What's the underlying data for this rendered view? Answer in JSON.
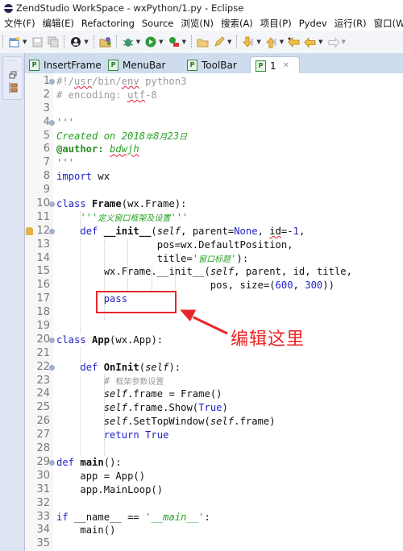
{
  "window": {
    "title": "ZendStudio WorkSpace - wxPython/1.py - Eclipse"
  },
  "menubar": {
    "items": [
      "文件(F)",
      "编辑(E)",
      "Refactoring",
      "Source",
      "浏览(N)",
      "搜索(A)",
      "项目(P)",
      "Pydev",
      "运行(R)",
      "窗口(W)"
    ]
  },
  "toolbar": {
    "icons": [
      "new-file-icon",
      "save-icon",
      "save-all-icon",
      "profile-icon",
      "open-project-icon",
      "debug-bug-icon",
      "run-icon",
      "external-tools-icon",
      "open-folder-icon",
      "pencil-icon",
      "next-annotation-icon",
      "prev-annotation-icon",
      "last-edit-icon",
      "back-icon",
      "forward-icon"
    ]
  },
  "tabs": [
    {
      "label": "InsertFrame",
      "active": false
    },
    {
      "label": "MenuBar",
      "active": false
    },
    {
      "label": "ToolBar",
      "active": false
    },
    {
      "label": "1",
      "active": true,
      "close": "✕"
    }
  ],
  "editor": {
    "lines": [
      {
        "n": "1",
        "text": "#!/usr/bin/env python3"
      },
      {
        "n": "2",
        "text": "# encoding: utf-8"
      },
      {
        "n": "3",
        "text": ""
      },
      {
        "n": "4",
        "text": "'''"
      },
      {
        "n": "5",
        "text": "Created on 2018年8月23日"
      },
      {
        "n": "6",
        "text": "@author: bdwjh"
      },
      {
        "n": "7",
        "text": "'''"
      },
      {
        "n": "8",
        "text": "import wx"
      },
      {
        "n": "9",
        "text": ""
      },
      {
        "n": "10",
        "text": "class Frame(wx.Frame):"
      },
      {
        "n": "11",
        "text": "    '''定义窗口框架及设置'''"
      },
      {
        "n": "12",
        "text": "    def __init__(self, parent=None, id=-1,"
      },
      {
        "n": "13",
        "text": "                 pos=wx.DefaultPosition,"
      },
      {
        "n": "14",
        "text": "                 title='窗口标题'):"
      },
      {
        "n": "15",
        "text": "        wx.Frame.__init__(self, parent, id, title,"
      },
      {
        "n": "16",
        "text": "                          pos, size=(600, 300))"
      },
      {
        "n": "17",
        "text": "        pass"
      },
      {
        "n": "18",
        "text": ""
      },
      {
        "n": "19",
        "text": ""
      },
      {
        "n": "20",
        "text": "class App(wx.App):"
      },
      {
        "n": "21",
        "text": ""
      },
      {
        "n": "22",
        "text": "    def OnInit(self):"
      },
      {
        "n": "23",
        "text": "        # 框架参数设置"
      },
      {
        "n": "24",
        "text": "        self.frame = Frame()"
      },
      {
        "n": "25",
        "text": "        self.frame.Show(True)"
      },
      {
        "n": "26",
        "text": "        self.SetTopWindow(self.frame)"
      },
      {
        "n": "27",
        "text": "        return True"
      },
      {
        "n": "28",
        "text": ""
      },
      {
        "n": "29",
        "text": "def main():"
      },
      {
        "n": "30",
        "text": "    app = App()"
      },
      {
        "n": "31",
        "text": "    app.MainLoop()"
      },
      {
        "n": "32",
        "text": ""
      },
      {
        "n": "33",
        "text": "if __name__ == '__main__':"
      },
      {
        "n": "34",
        "text": "    main()"
      },
      {
        "n": "35",
        "text": ""
      }
    ]
  },
  "annotation": {
    "callout_text": "编辑这里",
    "color": "#e8262a"
  }
}
